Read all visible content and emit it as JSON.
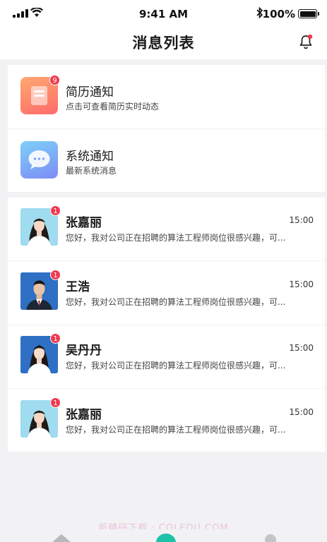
{
  "status_bar": {
    "time": "9:41 AM",
    "battery": "100%",
    "bluetooth_icon": "bluetooth-icon"
  },
  "header": {
    "title": "消息列表",
    "bell_icon": "bell-icon",
    "bell_dot_color": "#f0384f"
  },
  "system_notices": [
    {
      "title": "简历通知",
      "subtitle": "点击可查看简历实时动态",
      "badge": "9",
      "icon": "resume-icon"
    },
    {
      "title": "系统通知",
      "subtitle": "最新系统消息",
      "icon": "chat-bubble-icon"
    }
  ],
  "messages": [
    {
      "name": "张嘉丽",
      "time": "15:00",
      "badge": "1",
      "preview": "您好，我对公司正在招聘的算法工程师岗位很感兴趣，可..."
    },
    {
      "name": "王浩",
      "time": "15:00",
      "badge": "1",
      "preview": "您好，我对公司正在招聘的算法工程师岗位很感兴趣，可..."
    },
    {
      "name": "吴丹丹",
      "time": "15:00",
      "badge": "1",
      "preview": "您好，我对公司正在招聘的算法工程师岗位很感兴趣，可..."
    },
    {
      "name": "张嘉丽",
      "time": "15:00",
      "badge": "1",
      "preview": "您好，我对公司正在招聘的算法工程师岗位很感兴趣，可..."
    }
  ],
  "watermark": "新精研下载 · COLEDU.COM",
  "colors": {
    "accent": "#1cc3a8",
    "badge": "#f0384f"
  }
}
